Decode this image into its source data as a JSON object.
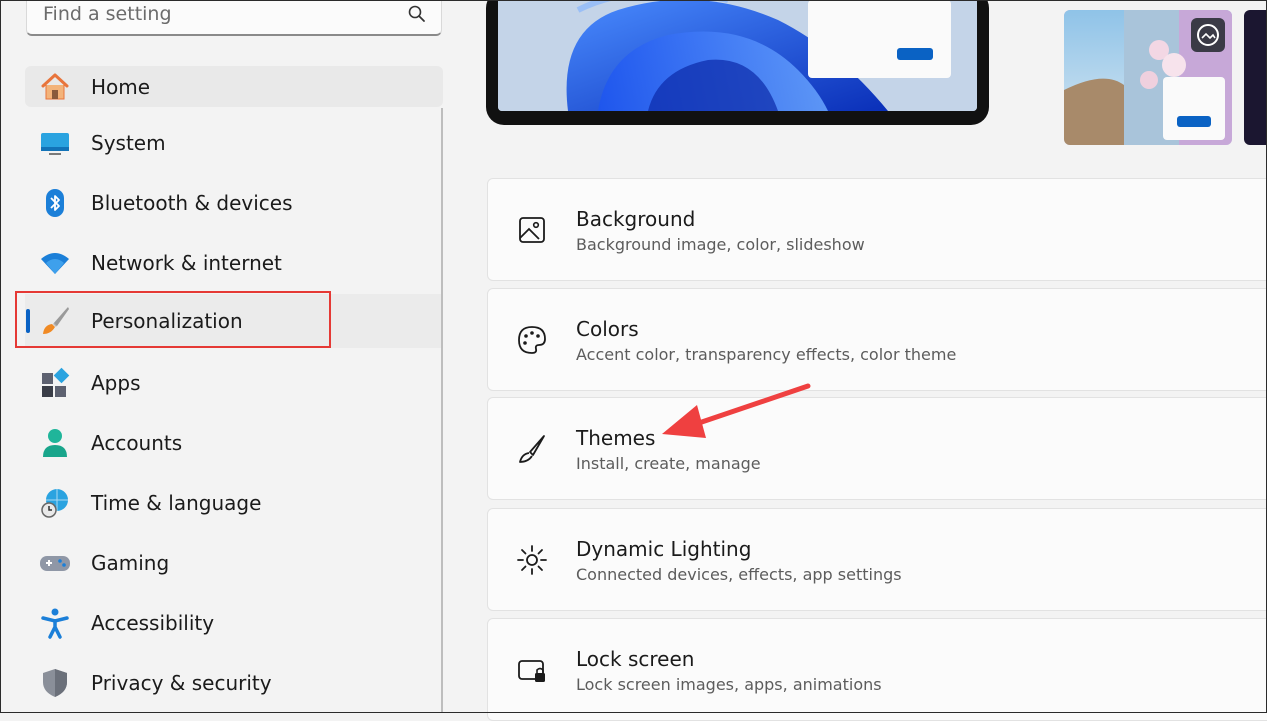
{
  "search": {
    "placeholder": "Find a setting"
  },
  "sidebar": {
    "items": [
      {
        "label": "Home"
      },
      {
        "label": "System"
      },
      {
        "label": "Bluetooth & devices"
      },
      {
        "label": "Network & internet"
      },
      {
        "label": "Personalization"
      },
      {
        "label": "Apps"
      },
      {
        "label": "Accounts"
      },
      {
        "label": "Time & language"
      },
      {
        "label": "Gaming"
      },
      {
        "label": "Accessibility"
      },
      {
        "label": "Privacy & security"
      }
    ]
  },
  "cards": [
    {
      "title": "Background",
      "desc": "Background image, color, slideshow"
    },
    {
      "title": "Colors",
      "desc": "Accent color, transparency effects, color theme"
    },
    {
      "title": "Themes",
      "desc": "Install, create, manage"
    },
    {
      "title": "Dynamic Lighting",
      "desc": "Connected devices, effects, app settings"
    },
    {
      "title": "Lock screen",
      "desc": "Lock screen images, apps, animations"
    }
  ],
  "colors": {
    "accent": "#0a62c4",
    "highlight": "#e53935"
  }
}
